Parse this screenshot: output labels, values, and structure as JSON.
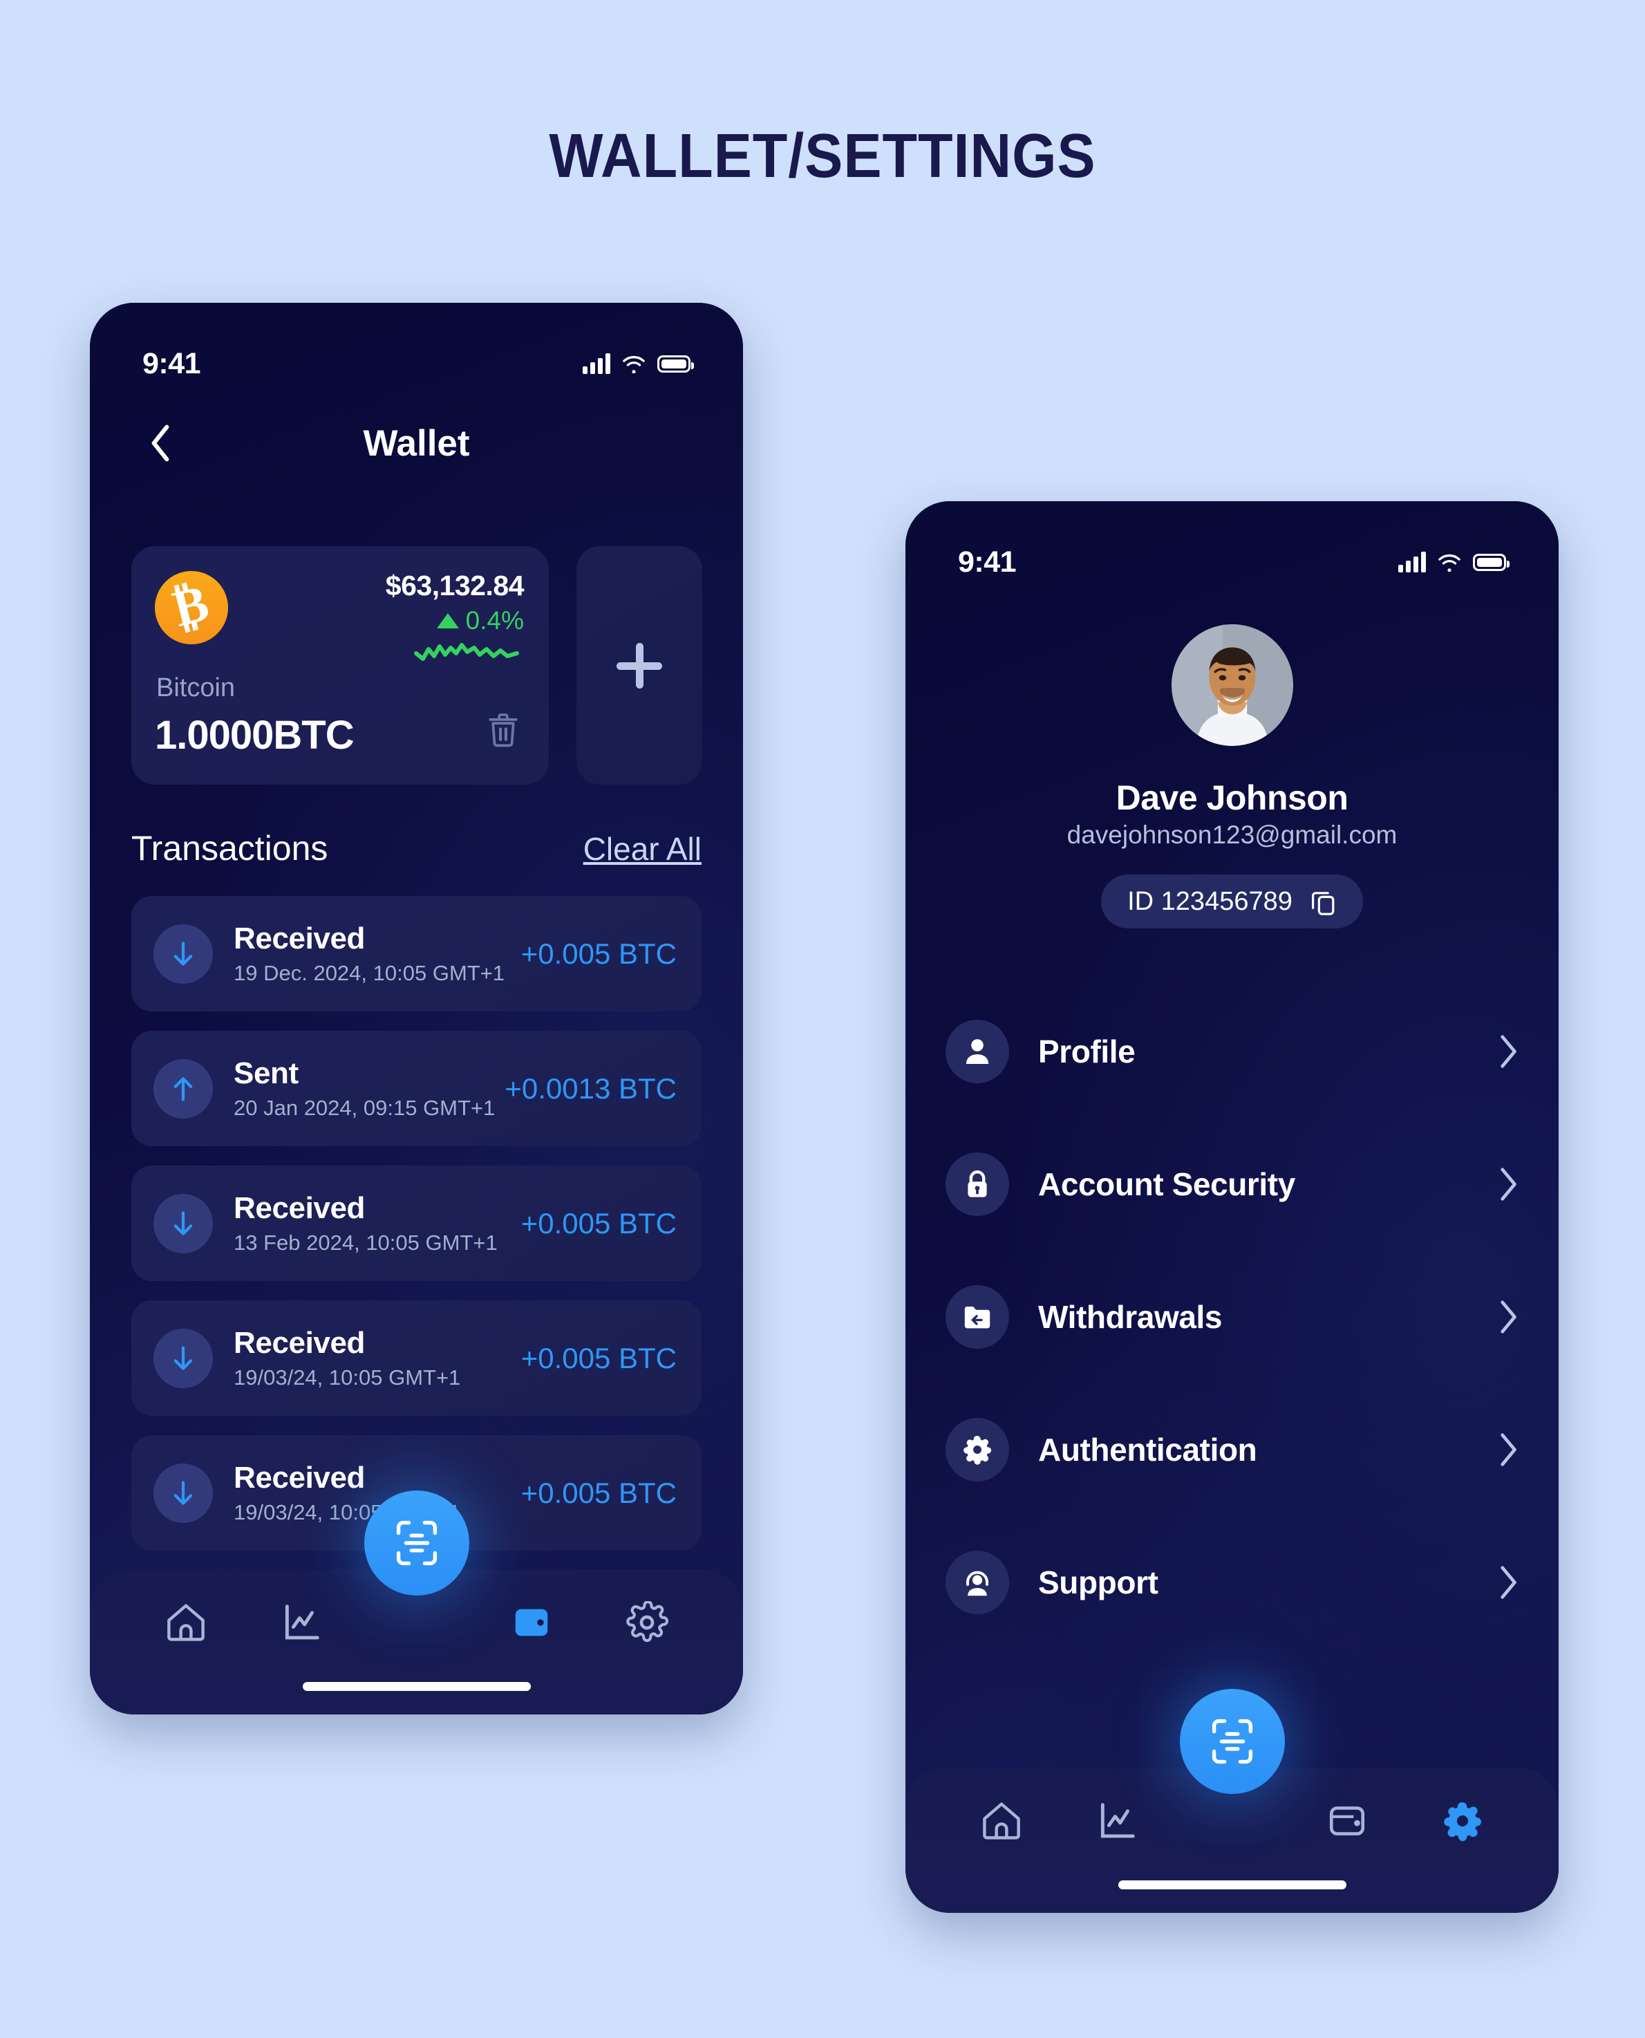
{
  "title": "WALLET/SETTINGS",
  "wallet_screen": {
    "status_bar": {
      "time": "9:41",
      "signal_icon": "signal-bars-icon",
      "wifi_icon": "wifi-icon",
      "battery_icon": "battery-icon"
    },
    "appbar": {
      "back_icon": "chevron-left-icon",
      "title": "Wallet"
    },
    "coin_card": {
      "logo_icon": "bitcoin-logo-icon",
      "logo_glyph": "₿",
      "price": "$63,132.84",
      "change": "0.4%",
      "change_direction_icon": "triangle-up-icon",
      "change_color": "#33D35E",
      "sparkline_color": "#33D35E",
      "name": "Bitcoin",
      "amount": "1.0000BTC",
      "delete_icon": "trash-icon"
    },
    "add_card": {
      "icon": "plus-icon",
      "label": "+"
    },
    "transactions_header": {
      "title": "Transactions",
      "clear_all": "Clear All"
    },
    "transactions": [
      {
        "type": "Received",
        "date": "19 Dec. 2024, 10:05 GMT+1",
        "amount": "+0.005 BTC",
        "direction_icon": "arrow-down-icon"
      },
      {
        "type": "Sent",
        "date": "20 Jan 2024, 09:15 GMT+1",
        "amount": "+0.0013 BTC",
        "direction_icon": "arrow-up-icon"
      },
      {
        "type": "Received",
        "date": "13 Feb 2024, 10:05 GMT+1",
        "amount": "+0.005 BTC",
        "direction_icon": "arrow-down-icon"
      },
      {
        "type": "Received",
        "date": "19/03/24, 10:05 GMT+1",
        "amount": "+0.005 BTC",
        "direction_icon": "arrow-down-icon"
      },
      {
        "type": "Received",
        "date": "19/03/24, 10:05 GMT+1",
        "amount": "+0.005 BTC",
        "direction_icon": "arrow-down-icon"
      }
    ],
    "nav": {
      "items": [
        {
          "icon": "home-icon",
          "active": false
        },
        {
          "icon": "chart-icon",
          "active": false
        },
        {
          "icon": "wallet-icon",
          "active": true
        },
        {
          "icon": "gear-icon",
          "active": false
        }
      ],
      "fab_icon": "face-scan-icon",
      "fab_color": "#2B8FF5"
    }
  },
  "settings_screen": {
    "status_bar": {
      "time": "9:41",
      "signal_icon": "signal-bars-icon",
      "wifi_icon": "wifi-icon",
      "battery_icon": "battery-icon"
    },
    "profile": {
      "avatar_icon": "user-avatar-photo",
      "name": "Dave Johnson",
      "email": "davejohnson123@gmail.com",
      "id_label": "ID 123456789",
      "copy_icon": "copy-icon"
    },
    "menu": [
      {
        "label": "Profile",
        "icon": "person-icon",
        "chevron": "chevron-right-icon"
      },
      {
        "label": "Account Security",
        "icon": "lock-icon",
        "chevron": "chevron-right-icon"
      },
      {
        "label": "Withdrawals",
        "icon": "withdraw-icon",
        "chevron": "chevron-right-icon"
      },
      {
        "label": "Authentication",
        "icon": "gear-icon",
        "chevron": "chevron-right-icon"
      },
      {
        "label": "Support",
        "icon": "headset-icon",
        "chevron": "chevron-right-icon"
      }
    ],
    "nav": {
      "items": [
        {
          "icon": "home-icon",
          "active": false
        },
        {
          "icon": "chart-icon",
          "active": false
        },
        {
          "icon": "wallet-icon",
          "active": false
        },
        {
          "icon": "gear-icon",
          "active": true
        }
      ],
      "fab_icon": "face-scan-icon",
      "fab_color": "#2B8FF5"
    }
  },
  "colors": {
    "page_bg": "#cfe0fc",
    "phone_bg": "#0b0b3d",
    "card_bg": "#1c1f56",
    "accent_blue": "#2E97F7",
    "accent_green": "#33D35E",
    "bitcoin_orange": "#F7931A",
    "title_navy": "#19194d"
  }
}
